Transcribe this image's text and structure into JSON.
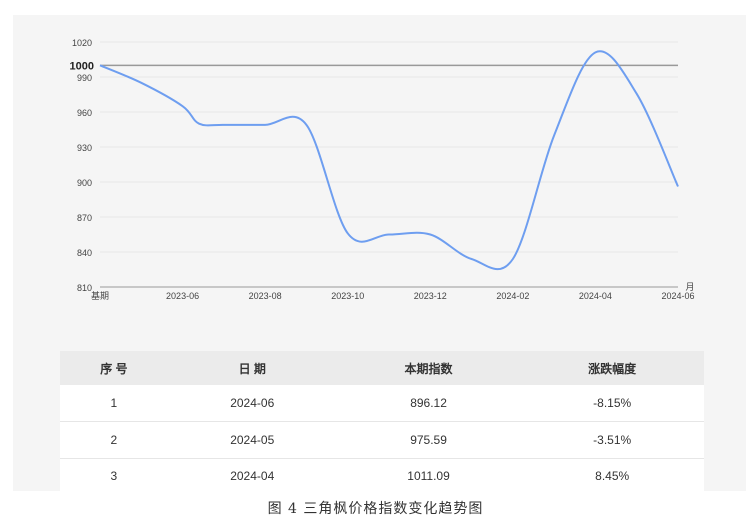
{
  "chart_data": {
    "type": "line",
    "unit_label": "月",
    "ylim": [
      810,
      1020
    ],
    "y_ticks": [
      810,
      840,
      870,
      900,
      930,
      960,
      990,
      1020
    ],
    "baseline": 1000,
    "x_ticks": [
      "基期",
      "2023-06",
      "2023-08",
      "2023-10",
      "2023-12",
      "2024-02",
      "2024-04",
      "2024-06"
    ],
    "series": [
      {
        "values": [
          {
            "x": "基期",
            "y": 1000
          },
          {
            "x": "2023-05",
            "y": 985
          },
          {
            "x": "2023-06",
            "y": 965
          },
          {
            "x": "2023-06",
            "y": 950
          },
          {
            "x": "2023-07",
            "y": 949
          },
          {
            "x": "2023-08",
            "y": 949
          },
          {
            "x": "2023-09",
            "y": 949
          },
          {
            "x": "2023-10",
            "y": 856
          },
          {
            "x": "2023-11",
            "y": 855
          },
          {
            "x": "2023-12",
            "y": 855
          },
          {
            "x": "2024-01",
            "y": 834
          },
          {
            "x": "2024-02",
            "y": 834
          },
          {
            "x": "2024-03",
            "y": 940
          },
          {
            "x": "2024-04",
            "y": 1011.09
          },
          {
            "x": "2024-05",
            "y": 975.59
          },
          {
            "x": "2024-06",
            "y": 896.12
          }
        ],
        "color": "#6e9ef0"
      }
    ],
    "grid": true
  },
  "table": {
    "headers": [
      "序 号",
      "日 期",
      "本期指数",
      "涨跌幅度"
    ],
    "rows": [
      [
        "1",
        "2024-06",
        "896.12",
        "-8.15%"
      ],
      [
        "2",
        "2024-05",
        "975.59",
        "-3.51%"
      ],
      [
        "3",
        "2024-04",
        "1011.09",
        "8.45%"
      ]
    ]
  },
  "caption": "图 4 三角枫价格指数变化趋势图"
}
